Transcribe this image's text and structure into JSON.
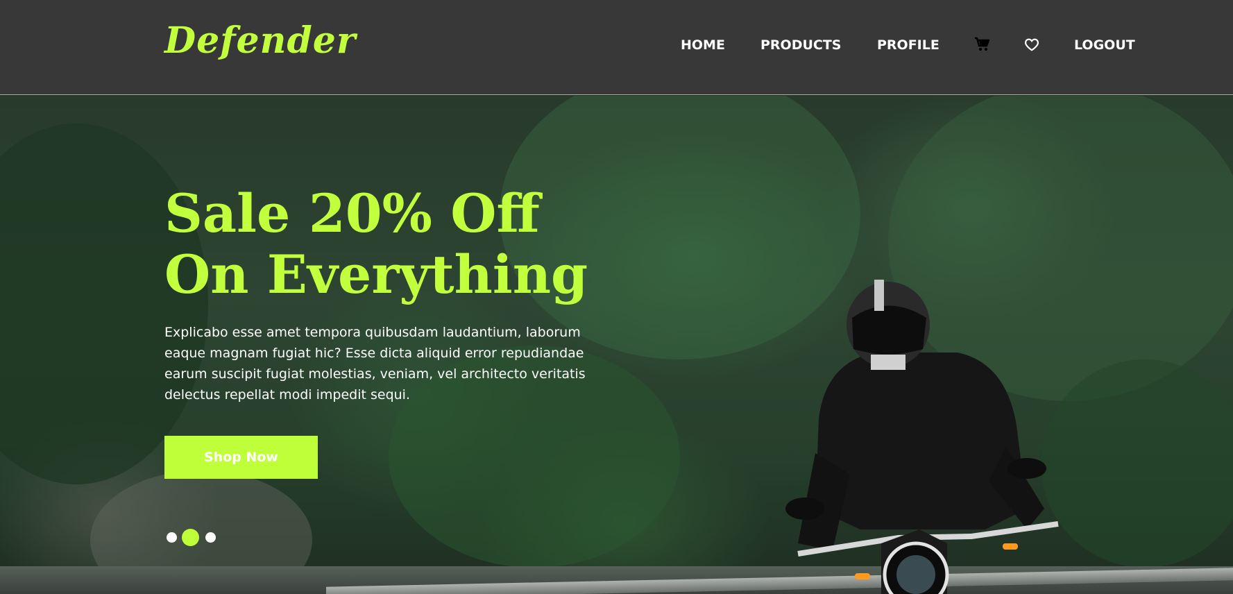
{
  "brand": {
    "name": "Defender",
    "color": "#c2ff3d"
  },
  "nav": {
    "home": "HOME",
    "products": "PRODUCTS",
    "profile": "PROFILE",
    "cart_icon": "cart-icon",
    "wishlist_icon": "heart-icon",
    "logout": "LOGOUT"
  },
  "hero": {
    "headline_line1": "Sale 20% Off",
    "headline_line2": "On Everything",
    "description_lines": [
      "Explicabo esse amet tempora quibusdam laudantium, laborum",
      "eaque magnam fugiat hic? Esse dicta aliquid error repudiandae",
      "earum suscipit fugiat molestias, veniam, vel architecto veritatis",
      "delectus repellat modi impedit sequi."
    ],
    "cta_label": "Shop Now",
    "cta_color": "#bfff3a",
    "slides": {
      "total": 3,
      "active": 2
    }
  },
  "colors": {
    "header_bg": "#383838",
    "accent": "#bfff3a"
  }
}
